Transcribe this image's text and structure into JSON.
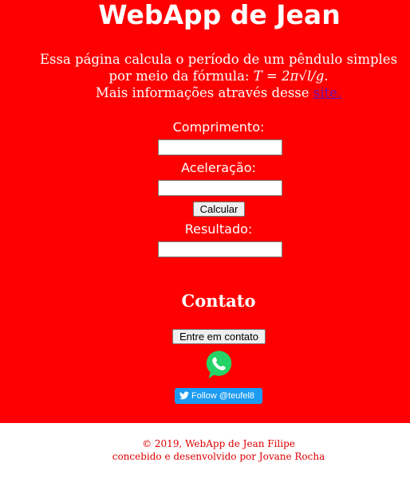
{
  "header": {
    "title": "WebApp de Jean"
  },
  "intro": {
    "line1": "Essa página calcula o período de um pêndulo simples",
    "line2_prefix": "por meio da fórmula: ",
    "formula": "T = 2π√l/g",
    "line2_suffix": ".",
    "line3_prefix": "Mais informações através desse ",
    "link_label": "site."
  },
  "form": {
    "length_label": "Comprimento:",
    "length_value": "",
    "acceleration_label": "Aceleração:",
    "acceleration_value": "",
    "calculate_label": "Calcular",
    "result_label": "Resultado:",
    "result_value": ""
  },
  "contact": {
    "title": "Contato",
    "button_label": "Entre em contato",
    "whatsapp_icon": "whatsapp-icon",
    "twitter_label": "Follow @teufel8"
  },
  "footer": {
    "line1": "© 2019, WebApp de Jean Filipe",
    "line2": "concebido e desenvolvido por Jovane Rocha"
  },
  "colors": {
    "background": "#ff0000",
    "text": "#ffffff",
    "footer_text": "#dd0000",
    "whatsapp_green": "#25d366",
    "twitter_blue": "#1d9bf0"
  }
}
